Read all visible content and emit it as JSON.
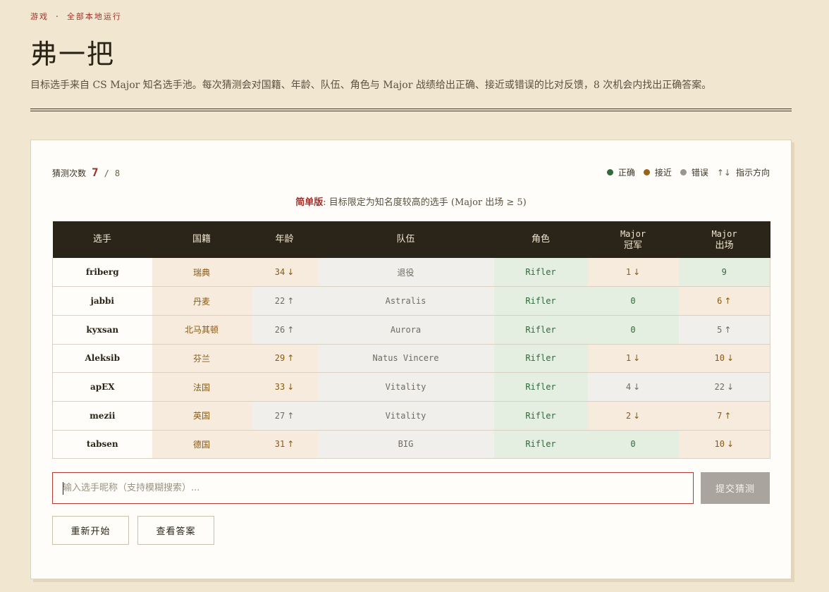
{
  "header": {
    "eyebrow": "游戏 · 全部本地运行",
    "title": "弗一把",
    "description": "目标选手来自 CS Major 知名选手池。每次猜测会对国籍、年龄、队伍、角色与 Major 战绩给出正确、接近或错误的比对反馈，8 次机会内找出正确答案。"
  },
  "counter": {
    "label": "猜测次数",
    "current": "7",
    "separator": "/",
    "max": "8"
  },
  "legend": {
    "correct": "正确",
    "close": "接近",
    "wrong": "错误",
    "direction_glyph": "↑↓",
    "direction": "指示方向",
    "colors": {
      "correct": "#2e6a3a",
      "close": "#9a6418",
      "wrong": "#9a968e"
    }
  },
  "notice": {
    "highlight": "简单版",
    "text": ": 目标限定为知名度较高的选手 (Major 出场 ≥ 5)"
  },
  "table": {
    "headers": {
      "player": "选手",
      "nationality": "国籍",
      "age": "年龄",
      "team": "队伍",
      "role": "角色",
      "major_wins_1": "Major",
      "major_wins_2": "冠军",
      "major_apps_1": "Major",
      "major_apps_2": "出场"
    },
    "rows": [
      {
        "name": "friberg",
        "nat": "瑞典",
        "nat_s": "close",
        "age": "34",
        "age_s": "close",
        "age_dir": "↓",
        "team": "退役",
        "team_s": "wrong",
        "role": "Rifler",
        "role_s": "correct",
        "wins": "1",
        "wins_s": "close",
        "wins_dir": "↓",
        "apps": "9",
        "apps_s": "correct",
        "apps_dir": ""
      },
      {
        "name": "jabbi",
        "nat": "丹麦",
        "nat_s": "close",
        "age": "22",
        "age_s": "wrong",
        "age_dir": "↑",
        "team": "Astralis",
        "team_s": "wrong",
        "role": "Rifler",
        "role_s": "correct",
        "wins": "0",
        "wins_s": "correct",
        "wins_dir": "",
        "apps": "6",
        "apps_s": "close",
        "apps_dir": "↑"
      },
      {
        "name": "kyxsan",
        "nat": "北马其顿",
        "nat_s": "close",
        "age": "26",
        "age_s": "wrong",
        "age_dir": "↑",
        "team": "Aurora",
        "team_s": "wrong",
        "role": "Rifler",
        "role_s": "correct",
        "wins": "0",
        "wins_s": "correct",
        "wins_dir": "",
        "apps": "5",
        "apps_s": "wrong",
        "apps_dir": "↑"
      },
      {
        "name": "Aleksib",
        "nat": "芬兰",
        "nat_s": "close",
        "age": "29",
        "age_s": "close",
        "age_dir": "↑",
        "team": "Natus Vincere",
        "team_s": "wrong",
        "role": "Rifler",
        "role_s": "correct",
        "wins": "1",
        "wins_s": "close",
        "wins_dir": "↓",
        "apps": "10",
        "apps_s": "close",
        "apps_dir": "↓"
      },
      {
        "name": "apEX",
        "nat": "法国",
        "nat_s": "close",
        "age": "33",
        "age_s": "close",
        "age_dir": "↓",
        "team": "Vitality",
        "team_s": "wrong",
        "role": "Rifler",
        "role_s": "correct",
        "wins": "4",
        "wins_s": "wrong",
        "wins_dir": "↓",
        "apps": "22",
        "apps_s": "wrong",
        "apps_dir": "↓"
      },
      {
        "name": "mezii",
        "nat": "英国",
        "nat_s": "close",
        "age": "27",
        "age_s": "wrong",
        "age_dir": "↑",
        "team": "Vitality",
        "team_s": "wrong",
        "role": "Rifler",
        "role_s": "correct",
        "wins": "2",
        "wins_s": "close",
        "wins_dir": "↓",
        "apps": "7",
        "apps_s": "close",
        "apps_dir": "↑"
      },
      {
        "name": "tabsen",
        "nat": "德国",
        "nat_s": "close",
        "age": "31",
        "age_s": "close",
        "age_dir": "↑",
        "team": "BIG",
        "team_s": "wrong",
        "role": "Rifler",
        "role_s": "correct",
        "wins": "0",
        "wins_s": "correct",
        "wins_dir": "",
        "apps": "10",
        "apps_s": "close",
        "apps_dir": "↓"
      }
    ]
  },
  "input": {
    "placeholder": "输入选手昵称（支持模糊搜索）...",
    "value": ""
  },
  "buttons": {
    "submit": "提交猜测",
    "restart": "重新开始",
    "answer": "查看答案"
  }
}
